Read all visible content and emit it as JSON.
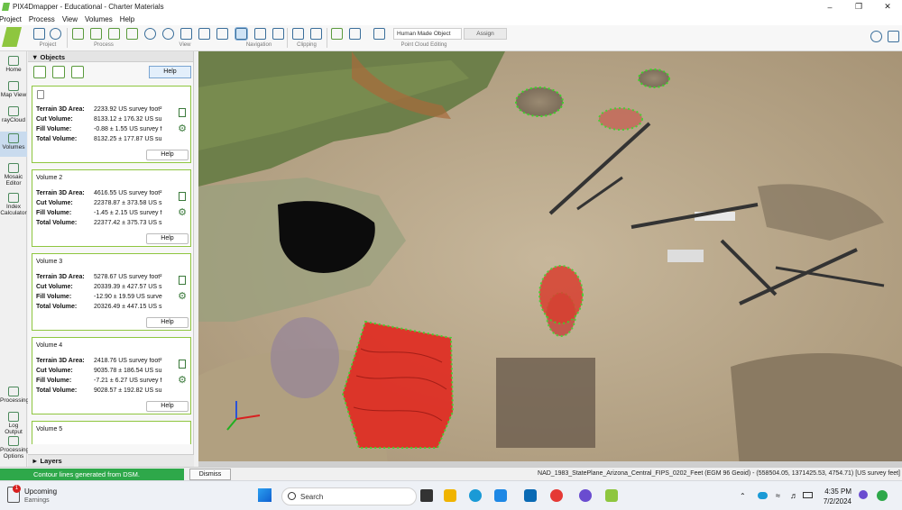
{
  "window": {
    "title": "PIX4Dmapper - Educational - Charter Materials"
  },
  "menu": [
    "Project",
    "Process",
    "View",
    "Volumes",
    "Help"
  ],
  "toolbar": {
    "groups": [
      "Project",
      "Process",
      "View",
      "Navigation",
      "Clipping",
      "Point Cloud Editing"
    ],
    "class_dropdown": "Human Made Object",
    "assign_label": "Assign"
  },
  "sidebar": {
    "items": [
      "Home",
      "Map View",
      "rayCloud",
      "Volumes",
      "Mosaic Editor",
      "Index Calculator",
      "Processing",
      "Log Output",
      "Processing Options"
    ]
  },
  "objects": {
    "header": "Objects",
    "help_label": "Help",
    "volumes": [
      {
        "title": "",
        "terrain_label": "Terrain 3D Area:",
        "terrain": "2233.92 US survey foot²",
        "cut_label": "Cut Volume:",
        "cut": "8133.12 ± 176.32 US su",
        "fill_label": "Fill Volume:",
        "fill": "-0.88 ± 1.55 US survey f",
        "total_label": "Total Volume:",
        "total": "8132.25 ± 177.87 US su",
        "help": "Help"
      },
      {
        "title": "Volume 2",
        "terrain_label": "Terrain 3D Area:",
        "terrain": "4616.55 US survey foot²",
        "cut_label": "Cut Volume:",
        "cut": "22378.87 ± 373.58 US s",
        "fill_label": "Fill Volume:",
        "fill": "-1.45 ± 2.15 US survey f",
        "total_label": "Total Volume:",
        "total": "22377.42 ± 375.73 US s",
        "help": "Help"
      },
      {
        "title": "Volume 3",
        "terrain_label": "Terrain 3D Area:",
        "terrain": "5278.67 US survey foot²",
        "cut_label": "Cut Volume:",
        "cut": "20339.39 ± 427.57 US s",
        "fill_label": "Fill Volume:",
        "fill": "-12.90 ± 19.59 US surve",
        "total_label": "Total Volume:",
        "total": "20326.49 ± 447.15 US s",
        "help": "Help"
      },
      {
        "title": "Volume 4",
        "terrain_label": "Terrain 3D Area:",
        "terrain": "2418.76 US survey foot²",
        "cut_label": "Cut Volume:",
        "cut": "9035.78 ± 186.54 US su",
        "fill_label": "Fill Volume:",
        "fill": "-7.21 ± 6.27 US survey f",
        "total_label": "Total Volume:",
        "total": "9028.57 ± 192.82 US su",
        "help": "Help"
      },
      {
        "title": "Volume 5"
      }
    ]
  },
  "layers": {
    "header": "Layers"
  },
  "status": {
    "message": "Contour lines generated from DSM.",
    "dismiss": "Dismiss",
    "coordinates": "NAD_1983_StatePlane_Arizona_Central_FIPS_0202_Feet (EGM 96 Geoid) - (558504.05, 1371425.53, 4754.71) [US survey feet]"
  },
  "taskbar": {
    "widget_title": "Upcoming",
    "widget_sub": "Earnings",
    "widget_badge": "1",
    "search_placeholder": "Search",
    "time": "4:35 PM",
    "date": "7/2/2024"
  },
  "colors": {
    "accent_green": "#2ea84a",
    "volume_outline": "#39d02a",
    "fill_red": "#e02020",
    "logo_green": "#8ec63f"
  }
}
